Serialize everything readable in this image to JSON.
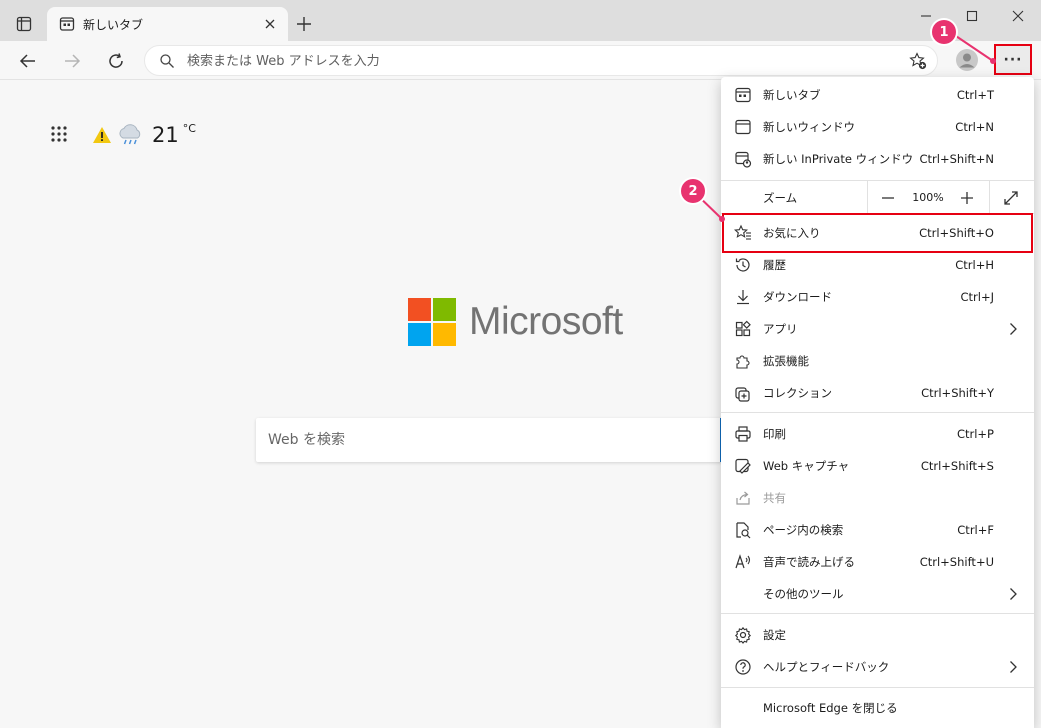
{
  "tab": {
    "title": "新しいタブ"
  },
  "toolbar": {
    "address_placeholder": "検索または Web アドレスを入力",
    "more_label": "···"
  },
  "callouts": [
    "1",
    "2"
  ],
  "weather": {
    "temperature": "21",
    "unit": "°C"
  },
  "logo": {
    "word": "Microsoft",
    "colors": [
      "#f25022",
      "#7fba00",
      "#00a4ef",
      "#ffb900"
    ]
  },
  "search": {
    "placeholder": "Web を検索"
  },
  "colors": {
    "highlight": "#e60012",
    "callout": "#e8336f",
    "accent": "#0f6cbd"
  },
  "menu": {
    "new_tab": {
      "label": "新しいタブ",
      "shortcut": "Ctrl+T"
    },
    "new_window": {
      "label": "新しいウィンドウ",
      "shortcut": "Ctrl+N"
    },
    "new_inprivate": {
      "label": "新しい InPrivate ウィンドウ",
      "shortcut": "Ctrl+Shift+N"
    },
    "zoom": {
      "label": "ズーム",
      "value": "100%"
    },
    "favorites": {
      "label": "お気に入り",
      "shortcut": "Ctrl+Shift+O"
    },
    "history": {
      "label": "履歴",
      "shortcut": "Ctrl+H"
    },
    "downloads": {
      "label": "ダウンロード",
      "shortcut": "Ctrl+J"
    },
    "apps": {
      "label": "アプリ"
    },
    "extensions": {
      "label": "拡張機能"
    },
    "collections": {
      "label": "コレクション",
      "shortcut": "Ctrl+Shift+Y"
    },
    "print": {
      "label": "印刷",
      "shortcut": "Ctrl+P"
    },
    "web_capture": {
      "label": "Web キャプチャ",
      "shortcut": "Ctrl+Shift+S"
    },
    "share": {
      "label": "共有"
    },
    "find": {
      "label": "ページ内の検索",
      "shortcut": "Ctrl+F"
    },
    "read_aloud": {
      "label": "音声で読み上げる",
      "shortcut": "Ctrl+Shift+U"
    },
    "more_tools": {
      "label": "その他のツール"
    },
    "settings": {
      "label": "設定"
    },
    "help": {
      "label": "ヘルプとフィードバック"
    },
    "close_edge": {
      "label": "Microsoft Edge を閉じる"
    }
  }
}
